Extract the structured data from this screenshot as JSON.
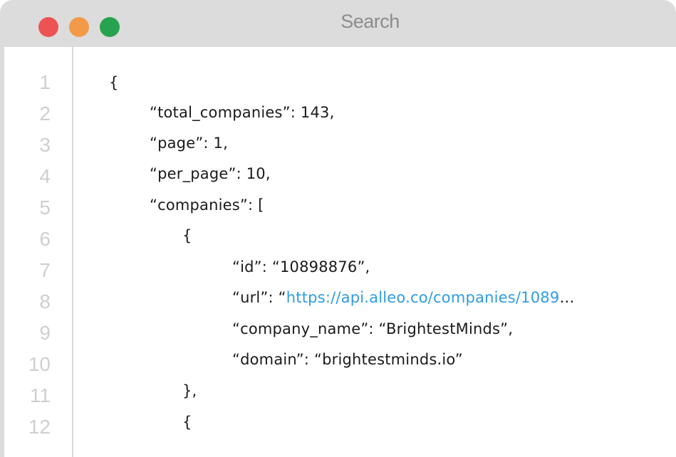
{
  "window": {
    "title": "Search",
    "controls": [
      {
        "name": "close",
        "color": "#ee5353"
      },
      {
        "name": "minimize",
        "color": "#f39a49"
      },
      {
        "name": "maximize",
        "color": "#27a34f"
      }
    ]
  },
  "editor": {
    "line_numbers": [
      "1",
      "2",
      "3",
      "4",
      "5",
      "6",
      "7",
      "8",
      "9",
      "10",
      "11",
      "12"
    ],
    "lines": [
      {
        "text": "{"
      },
      {
        "text": "“total_companies”: 143,"
      },
      {
        "text": "“page”: 1,"
      },
      {
        "text": "“per_page”: 10,"
      },
      {
        "text": "“companies”: ["
      },
      {
        "text": "{"
      },
      {
        "text": "“id”: “10898876”,"
      },
      {
        "prefix": "“url”: “",
        "link": "https://api.alleo.co/companies/1089",
        "suffix": "…"
      },
      {
        "text": "“company_name”: “BrightestMinds”,"
      },
      {
        "text": "“domain”: “brightestminds.io”"
      },
      {
        "text": "},"
      },
      {
        "text": "{"
      }
    ],
    "colors": {
      "text": "#1a1a1a",
      "link": "#2e9de0",
      "line_number": "#cfcfcf"
    }
  }
}
